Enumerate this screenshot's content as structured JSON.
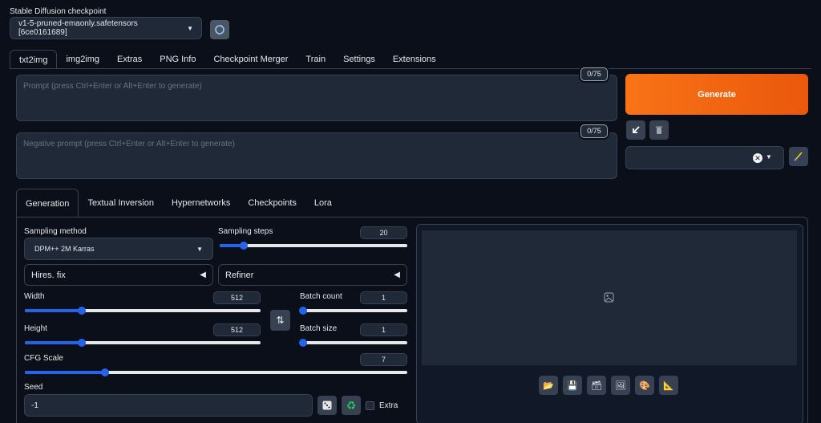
{
  "checkpoint": {
    "label": "Stable Diffusion checkpoint",
    "value": "v1-5-pruned-emaonly.safetensors [6ce0161689]"
  },
  "main_tabs": [
    "txt2img",
    "img2img",
    "Extras",
    "PNG Info",
    "Checkpoint Merger",
    "Train",
    "Settings",
    "Extensions"
  ],
  "prompt": {
    "placeholder": "Prompt (press Ctrl+Enter or Alt+Enter to generate)",
    "counter": "0/75"
  },
  "negative_prompt": {
    "placeholder": "Negative prompt (press Ctrl+Enter or Alt+Enter to generate)",
    "counter": "0/75"
  },
  "generate_label": "Generate",
  "sub_tabs": [
    "Generation",
    "Textual Inversion",
    "Hypernetworks",
    "Checkpoints",
    "Lora"
  ],
  "sampling_method": {
    "label": "Sampling method",
    "value": "DPM++ 2M Karras"
  },
  "sampling_steps": {
    "label": "Sampling steps",
    "value": "20",
    "fraction": 0.13
  },
  "hires_fix": {
    "label": "Hires. fix"
  },
  "refiner": {
    "label": "Refiner"
  },
  "width": {
    "label": "Width",
    "value": "512",
    "fraction": 0.24
  },
  "height": {
    "label": "Height",
    "value": "512",
    "fraction": 0.24
  },
  "batch_count": {
    "label": "Batch count",
    "value": "1",
    "fraction": 0.0
  },
  "batch_size": {
    "label": "Batch size",
    "value": "1",
    "fraction": 0.0
  },
  "cfg_scale": {
    "label": "CFG Scale",
    "value": "7",
    "fraction": 0.21
  },
  "seed": {
    "label": "Seed",
    "value": "-1"
  },
  "extra_label": "Extra",
  "colors": {
    "accent": "#2563eb",
    "generate_start": "#f97316",
    "generate_end": "#ea580c"
  }
}
